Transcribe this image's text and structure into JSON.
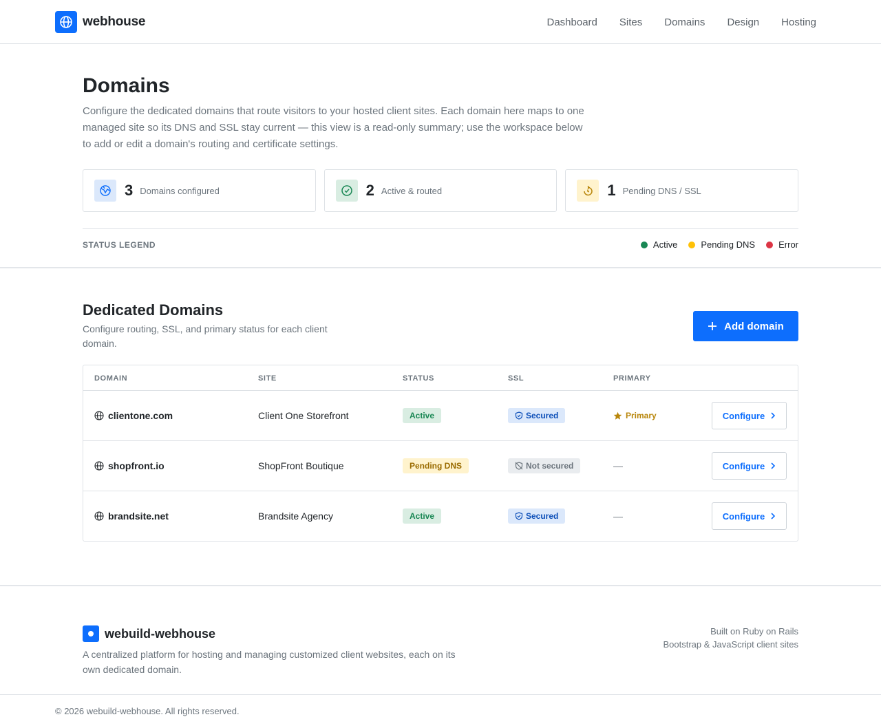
{
  "brand": {
    "name": "webhouse"
  },
  "nav": {
    "items": [
      {
        "label": "Dashboard"
      },
      {
        "label": "Sites"
      },
      {
        "label": "Domains"
      },
      {
        "label": "Design"
      },
      {
        "label": "Hosting"
      }
    ]
  },
  "hero": {
    "title": "Domains",
    "description": "Configure the dedicated domains that route visitors to your hosted client sites. Each domain here maps to one managed site so its DNS and SSL stay current — this view is a read-only summary; use the workspace below to add or edit a domain's routing and certificate settings."
  },
  "stats": [
    {
      "value": "3",
      "label": "Domains configured",
      "icon": "globe-icon"
    },
    {
      "value": "2",
      "label": "Active & routed",
      "icon": "check-circle-icon"
    },
    {
      "value": "1",
      "label": "Pending DNS / SSL",
      "icon": "pending-icon"
    }
  ],
  "legend": {
    "title": "STATUS LEGEND",
    "items": [
      {
        "label": "Active",
        "color": "#198754"
      },
      {
        "label": "Pending DNS",
        "color": "#ffc107"
      },
      {
        "label": "Error",
        "color": "#dc3545"
      }
    ]
  },
  "domains_section": {
    "title": "Dedicated Domains",
    "description": "Configure routing, SSL, and primary status for each client domain.",
    "add_label": "Add domain",
    "columns": [
      "DOMAIN",
      "SITE",
      "STATUS",
      "SSL",
      "PRIMARY"
    ],
    "configure_label": "Configure",
    "rows": [
      {
        "domain": "clientone.com",
        "site": "Client One Storefront",
        "status": "Active",
        "ssl": "Secured",
        "primary": "Primary"
      },
      {
        "domain": "shopfront.io",
        "site": "ShopFront Boutique",
        "status": "Pending DNS",
        "ssl": "Not secured",
        "primary": "—"
      },
      {
        "domain": "brandsite.net",
        "site": "Brandsite Agency",
        "status": "Active",
        "ssl": "Secured",
        "primary": "—"
      }
    ]
  },
  "footer": {
    "brand": "webuild-webhouse",
    "description": "A centralized platform for hosting and managing customized client websites, each on its own dedicated domain.",
    "tech_line1": "Built on Ruby on Rails",
    "tech_line2": "Bootstrap & JavaScript client sites",
    "copyright": "© 2026 webuild-webhouse. All rights reserved."
  },
  "colors": {
    "accent": "#0d6efd",
    "active": "#198754",
    "pending": "#ffc107",
    "error": "#dc3545",
    "primary_star": "#b8860b"
  }
}
